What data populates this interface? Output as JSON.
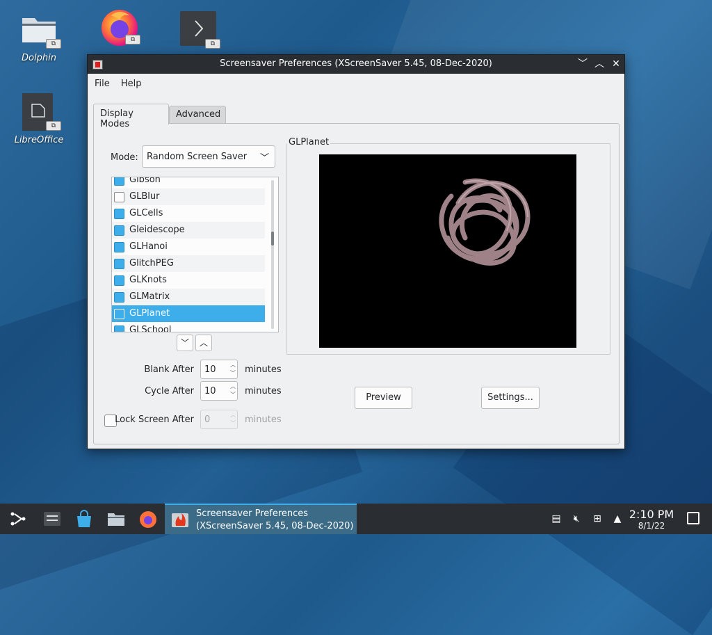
{
  "desktop": {
    "icons": [
      {
        "label": "Dolphin",
        "icon": "folder-icon"
      },
      {
        "label": "",
        "icon": "firefox-icon"
      },
      {
        "label": "",
        "icon": "terminal-icon"
      },
      {
        "label": "LibreOffice",
        "icon": "document-icon"
      }
    ],
    "link_badge": "⧉"
  },
  "window": {
    "title": "Screensaver Preferences (XScreenSaver 5.45, 08-Dec-2020)",
    "controls": {
      "minimize": "﹀",
      "maximize": "︿",
      "close": "✕"
    },
    "menu": {
      "file": "File",
      "help": "Help"
    },
    "tabs": {
      "display_modes": "Display Modes",
      "advanced": "Advanced"
    },
    "mode": {
      "label": "Mode:",
      "value": "Random Screen Saver"
    },
    "savers": [
      {
        "name": "Gibson",
        "checked": true
      },
      {
        "name": "GLBlur",
        "checked": false
      },
      {
        "name": "GLCells",
        "checked": true
      },
      {
        "name": "Gleidescope",
        "checked": true
      },
      {
        "name": "GLHanoi",
        "checked": true
      },
      {
        "name": "GlitchPEG",
        "checked": true
      },
      {
        "name": "GLKnots",
        "checked": true
      },
      {
        "name": "GLMatrix",
        "checked": true
      },
      {
        "name": "GLPlanet",
        "checked": false,
        "selected": true
      },
      {
        "name": "GLSchool",
        "checked": true
      }
    ],
    "preview_title": "GLPlanet",
    "blank_after": {
      "label": "Blank After",
      "value": "10",
      "unit": "minutes"
    },
    "cycle_after": {
      "label": "Cycle After",
      "value": "10",
      "unit": "minutes"
    },
    "lock_after": {
      "label": "Lock Screen After",
      "value": "0",
      "unit": "minutes",
      "checked": false
    },
    "buttons": {
      "preview": "Preview",
      "settings": "Settings..."
    }
  },
  "taskbar": {
    "task_line1": "Screensaver Preferences",
    "task_line2": "(XScreenSaver 5.45, 08-Dec-2020)",
    "time": "2:10 PM",
    "date": "8/1/22"
  },
  "colors": {
    "accent": "#3daee9",
    "taskbar": "#2a2e32",
    "window_bg": "#eff0f1"
  }
}
